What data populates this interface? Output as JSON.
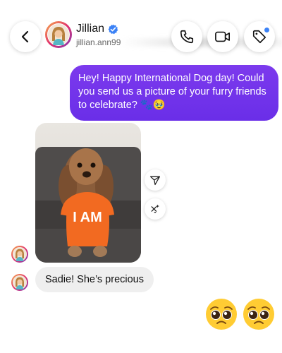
{
  "header": {
    "name": "Jillian",
    "username": "jillian.ann99",
    "verified": true,
    "icons": [
      "back-arrow-icon",
      "phone-icon",
      "video-icon",
      "tag-icon"
    ],
    "accent": "#3b82f6"
  },
  "messages": {
    "sent_text": "Hey! Happy International Dog day! Could you send us a picture of your furry friends to celebrate? 🐾🥹",
    "photo_shirt_text": "I AM",
    "reply_text": "Sadie! She’s precious",
    "reaction_emojis": [
      "🥹",
      "🥹"
    ]
  },
  "colors": {
    "sent_bubble": "#7c3aed",
    "received_bubble": "#efefef"
  }
}
